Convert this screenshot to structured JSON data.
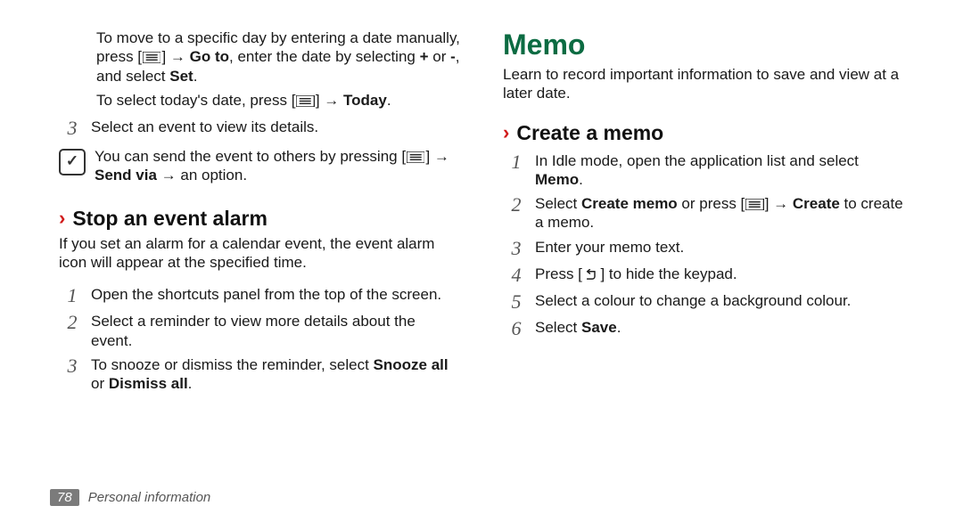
{
  "left": {
    "tips": {
      "goto_pre": "To move to a specific day by entering a date manually, press [",
      "goto_mid1": "] → ",
      "goto_b1": "Go to",
      "goto_mid2": ", enter the date by selecting ",
      "goto_b2": "+",
      "goto_mid3": " or ",
      "goto_b3": "-",
      "goto_mid4": ", and select ",
      "goto_b4": "Set",
      "goto_end": ".",
      "today_pre": "To select today's date, press [",
      "today_mid": "] → ",
      "today_b": "Today",
      "today_end": "."
    },
    "step3": "Select an event to view its details.",
    "note": {
      "pre": "You can send the event to others by pressing [",
      "mid1": "] → ",
      "b1": "Send via",
      "mid2": " → an option."
    },
    "stop": {
      "heading": "Stop an event alarm",
      "intro": "If you set an alarm for a calendar event, the event alarm icon will appear at the specified time.",
      "s1": "Open the shortcuts panel from the top of the screen.",
      "s2": "Select a reminder to view more details about the event.",
      "s3_pre": "To snooze or dismiss the reminder, select ",
      "s3_b1": "Snooze all",
      "s3_mid": " or ",
      "s3_b2": "Dismiss all",
      "s3_end": "."
    }
  },
  "right": {
    "title": "Memo",
    "intro": "Learn to record important information to save and view at a later date.",
    "create": {
      "heading": "Create a memo",
      "s1_pre": "In Idle mode, open the application list and select ",
      "s1_b": "Memo",
      "s1_end": ".",
      "s2_pre": "Select ",
      "s2_b1": "Create memo",
      "s2_mid1": " or press [",
      "s2_mid2": "] → ",
      "s2_b2": "Create",
      "s2_mid3": " to create a memo.",
      "s3": "Enter your memo text.",
      "s4_pre": "Press [",
      "s4_post": "] to hide the keypad.",
      "s5": "Select a colour to change a background colour.",
      "s6_pre": "Select ",
      "s6_b": "Save",
      "s6_end": "."
    }
  },
  "footer": {
    "page": "78",
    "section": "Personal information"
  },
  "nums": {
    "n1": "1",
    "n2": "2",
    "n3": "3",
    "n4": "4",
    "n5": "5",
    "n6": "6"
  }
}
